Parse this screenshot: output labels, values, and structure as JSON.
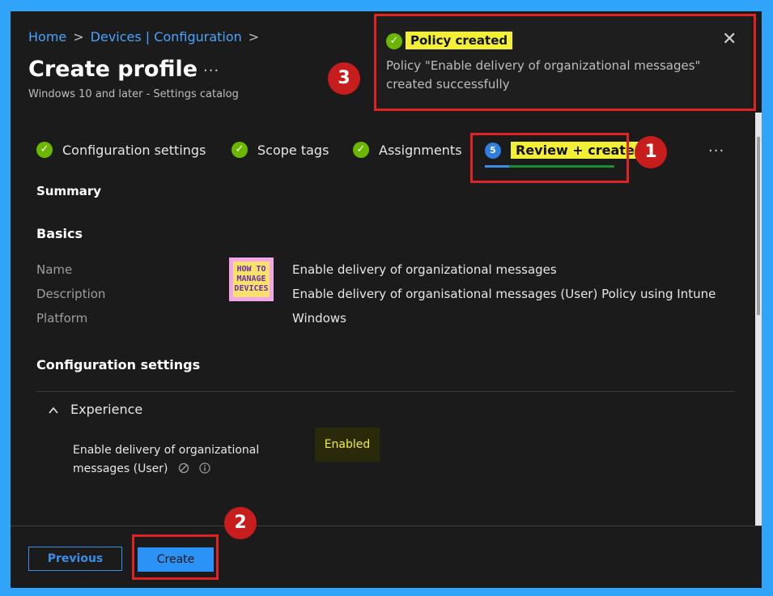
{
  "breadcrumb": {
    "home": "Home",
    "devices": "Devices | Configuration",
    "sep": ">"
  },
  "header": {
    "title": "Create profile",
    "more": "···",
    "subtitle": "Windows 10 and later - Settings catalog"
  },
  "toast": {
    "title": "Policy created",
    "message": "Policy \"Enable delivery of organizational messages\" created successfully",
    "close": "✕"
  },
  "steps": [
    {
      "label": "Configuration settings",
      "status": "complete"
    },
    {
      "label": "Scope tags",
      "status": "complete"
    },
    {
      "label": "Assignments",
      "status": "complete"
    },
    {
      "label": "Review + create",
      "number": "5",
      "status": "current"
    }
  ],
  "steps_more": "···",
  "callouts": {
    "one": "1",
    "two": "2",
    "three": "3"
  },
  "summary": {
    "heading": "Summary",
    "basics_heading": "Basics",
    "rows": [
      {
        "label": "Name",
        "value": "Enable delivery of organizational messages"
      },
      {
        "label": "Description",
        "value": "Enable delivery of organisational messages (User) Policy using Intune"
      },
      {
        "label": "Platform",
        "value": "Windows"
      }
    ],
    "logo_text": [
      "HOW TO",
      "MANAGE",
      "DEVICES"
    ]
  },
  "config": {
    "heading": "Configuration settings",
    "section": "Experience",
    "setting_label": "Enable delivery of organizational messages (User)",
    "setting_value": "Enabled"
  },
  "footer": {
    "previous": "Previous",
    "create": "Create"
  },
  "colors": {
    "accent_blue": "#2a93f5",
    "highlight_yellow": "#f2ef34",
    "callout_red": "#c81d1d",
    "success_green": "#6bb700"
  }
}
